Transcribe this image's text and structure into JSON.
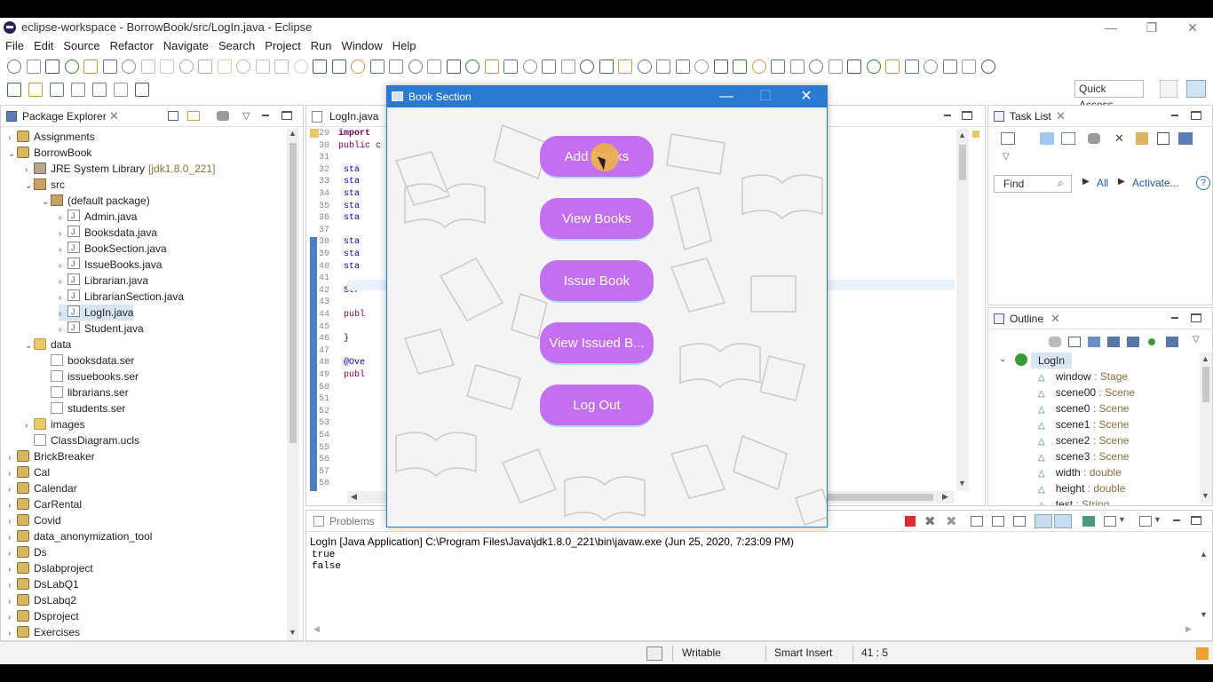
{
  "window": {
    "title": "eclipse-workspace - BorrowBook/src/LogIn.java - Eclipse",
    "minimize": "—",
    "restore": "❐",
    "close": "✕"
  },
  "menu": [
    "File",
    "Edit",
    "Source",
    "Refactor",
    "Navigate",
    "Search",
    "Project",
    "Run",
    "Window",
    "Help"
  ],
  "quick_access": "Quick Access",
  "package_explorer": {
    "title": "Package Explorer",
    "tree": [
      {
        "label": "Assignments",
        "level": 0,
        "arrow": "›",
        "icon": "proj"
      },
      {
        "label": "BorrowBook",
        "level": 0,
        "arrow": "⌄",
        "icon": "proj"
      },
      {
        "label": "JRE System Library",
        "extra": "[jdk1.8.0_221]",
        "level": 1,
        "arrow": "›",
        "icon": "lib"
      },
      {
        "label": "src",
        "level": 1,
        "arrow": "⌄",
        "icon": "pkg"
      },
      {
        "label": "(default package)",
        "level": 2,
        "arrow": "⌄",
        "icon": "pkg"
      },
      {
        "label": "Admin.java",
        "level": 3,
        "arrow": "›",
        "icon": "jfile"
      },
      {
        "label": "Booksdata.java",
        "level": 3,
        "arrow": "›",
        "icon": "jfile"
      },
      {
        "label": "BookSection.java",
        "level": 3,
        "arrow": "›",
        "icon": "jfile"
      },
      {
        "label": "IssueBooks.java",
        "level": 3,
        "arrow": "›",
        "icon": "jfile"
      },
      {
        "label": "Librarian.java",
        "level": 3,
        "arrow": "›",
        "icon": "jfile"
      },
      {
        "label": "LibrarianSection.java",
        "level": 3,
        "arrow": "›",
        "icon": "jfile"
      },
      {
        "label": "LogIn.java",
        "level": 3,
        "arrow": "›",
        "icon": "jfile",
        "selected": true
      },
      {
        "label": "Student.java",
        "level": 3,
        "arrow": "›",
        "icon": "jfile"
      },
      {
        "label": "data",
        "level": 1,
        "arrow": "⌄",
        "icon": "folder"
      },
      {
        "label": "booksdata.ser",
        "level": 2,
        "arrow": "",
        "icon": "ser"
      },
      {
        "label": "issuebooks.ser",
        "level": 2,
        "arrow": "",
        "icon": "ser"
      },
      {
        "label": "librarians.ser",
        "level": 2,
        "arrow": "",
        "icon": "ser"
      },
      {
        "label": "students.ser",
        "level": 2,
        "arrow": "",
        "icon": "ser"
      },
      {
        "label": "images",
        "level": 1,
        "arrow": "›",
        "icon": "folder"
      },
      {
        "label": "ClassDiagram.ucls",
        "level": 1,
        "arrow": "",
        "icon": "ser"
      },
      {
        "label": "BrickBreaker",
        "level": 0,
        "arrow": "›",
        "icon": "proj"
      },
      {
        "label": "Cal",
        "level": 0,
        "arrow": "›",
        "icon": "proj"
      },
      {
        "label": "Calendar",
        "level": 0,
        "arrow": "›",
        "icon": "proj"
      },
      {
        "label": "CarRental",
        "level": 0,
        "arrow": "›",
        "icon": "proj"
      },
      {
        "label": "Covid",
        "level": 0,
        "arrow": "›",
        "icon": "proj"
      },
      {
        "label": "data_anonymization_tool",
        "level": 0,
        "arrow": "›",
        "icon": "proj"
      },
      {
        "label": "Ds",
        "level": 0,
        "arrow": "›",
        "icon": "proj"
      },
      {
        "label": "Dslabproject",
        "level": 0,
        "arrow": "›",
        "icon": "proj"
      },
      {
        "label": "DsLabQ1",
        "level": 0,
        "arrow": "›",
        "icon": "proj"
      },
      {
        "label": "DsLabq2",
        "level": 0,
        "arrow": "›",
        "icon": "proj"
      },
      {
        "label": "Dsproject",
        "level": 0,
        "arrow": "›",
        "icon": "proj"
      },
      {
        "label": "Exercises",
        "level": 0,
        "arrow": "›",
        "icon": "proj"
      }
    ]
  },
  "editor": {
    "tab": "LogIn.java",
    "lines": [
      {
        "num": "29",
        "code": ""
      },
      {
        "num": "30",
        "code": "public c"
      },
      {
        "num": "31",
        "code": ""
      },
      {
        "num": "32",
        "code": "    sta"
      },
      {
        "num": "33",
        "code": "    sta"
      },
      {
        "num": "34",
        "code": "    sta"
      },
      {
        "num": "35",
        "code": "    sta"
      },
      {
        "num": "36",
        "code": "    sta"
      },
      {
        "num": "37",
        "code": ""
      },
      {
        "num": "38",
        "code": "    sta"
      },
      {
        "num": "39",
        "code": "    sta"
      },
      {
        "num": "40",
        "code": "    sta"
      },
      {
        "num": "41",
        "code": ""
      },
      {
        "num": "42",
        "code": "     Str"
      },
      {
        "num": "43",
        "code": ""
      },
      {
        "num": "44",
        "code": "    publ"
      },
      {
        "num": "45",
        "code": ""
      },
      {
        "num": "46",
        "code": "    }"
      },
      {
        "num": "47",
        "code": ""
      },
      {
        "num": "48",
        "code": "    @Ove"
      },
      {
        "num": "49",
        "code": "    publ"
      },
      {
        "num": "50",
        "code": ""
      },
      {
        "num": "51",
        "code": ""
      },
      {
        "num": "52",
        "code": ""
      },
      {
        "num": "53",
        "code": ""
      },
      {
        "num": "54",
        "code": ""
      },
      {
        "num": "55",
        "code": ""
      },
      {
        "num": "56",
        "code": ""
      },
      {
        "num": "57",
        "code": ""
      },
      {
        "num": "58",
        "code": ""
      }
    ],
    "first_line": "import"
  },
  "task_list": {
    "title": "Task List",
    "find_placeholder": "Find",
    "all": "All",
    "activate": "Activate..."
  },
  "outline": {
    "title": "Outline",
    "root": "LogIn",
    "members": [
      {
        "name": "window",
        "type": " : Stage"
      },
      {
        "name": "scene00",
        "type": " : Scene"
      },
      {
        "name": "scene0",
        "type": " : Scene"
      },
      {
        "name": "scene1",
        "type": " : Scene"
      },
      {
        "name": "scene2",
        "type": " : Scene"
      },
      {
        "name": "scene3",
        "type": " : Scene"
      },
      {
        "name": "width",
        "type": " : double"
      },
      {
        "name": "height",
        "type": " : double"
      },
      {
        "name": "test",
        "type": " : String"
      }
    ]
  },
  "console": {
    "tab": "Problems",
    "header": "LogIn [Java Application] C:\\Program Files\\Java\\jdk1.8.0_221\\bin\\javaw.exe (Jun 25, 2020, 7:23:09 PM)",
    "output": [
      "true",
      "false"
    ]
  },
  "status": {
    "writable": "Writable",
    "insert": "Smart Insert",
    "position": "41 : 5"
  },
  "dialog": {
    "title": "Book Section",
    "buttons": [
      "Add Books",
      "View Books",
      "Issue Book",
      "View Issued B...",
      "Log Out"
    ],
    "button_color": "#c46ef0",
    "title_color": "#2b79d0"
  }
}
